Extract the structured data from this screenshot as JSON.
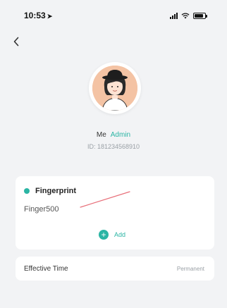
{
  "status_bar": {
    "time": "10:53",
    "location_glyph": "➤",
    "battery_level": 0.85
  },
  "nav": {
    "back_icon": "chevron-left-icon"
  },
  "profile": {
    "name": "Me",
    "role": "Admin",
    "account": "ID: 181234568910"
  },
  "fingerprint_card": {
    "title": "Fingerprint",
    "items": [
      "Finger500"
    ],
    "add_label": "Add",
    "accent": "#2bb5a4"
  },
  "effective_time": {
    "label": "Effective Time",
    "value": "Permanent"
  }
}
